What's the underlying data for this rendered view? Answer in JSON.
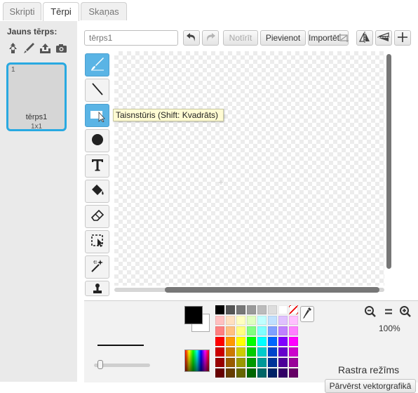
{
  "tabs": [
    {
      "label": "Skripti",
      "active": false
    },
    {
      "label": "Tērpi",
      "active": true
    },
    {
      "label": "Skaņas",
      "active": false
    }
  ],
  "sidebar": {
    "new_costume_label": "Jauns tērps:",
    "new_costume_icons": [
      "sprite-library-icon",
      "paint-brush-icon",
      "upload-icon",
      "camera-icon"
    ],
    "costume": {
      "number": "1",
      "name": "tērps1",
      "size": "1x1"
    }
  },
  "toolbar": {
    "name_placeholder": "tērps1",
    "undo_icon": "undo-icon",
    "redo_icon": "redo-icon",
    "clear_label": "Notīrīt",
    "add_label": "Pievienot",
    "import_label": "Importēt",
    "right_icons": [
      "flip-horizontal-icon",
      "flip-vertical-icon",
      "set-costume-center-icon"
    ]
  },
  "tools": [
    {
      "name": "brush-tool",
      "icon": "paintbrush-icon",
      "selected": true
    },
    {
      "name": "line-tool",
      "icon": "line-icon",
      "selected": false
    },
    {
      "name": "rectangle-tool",
      "icon": "rectangle-icon",
      "selected": true
    },
    {
      "name": "ellipse-tool",
      "icon": "ellipse-icon",
      "selected": false
    },
    {
      "name": "text-tool",
      "icon": "text-icon",
      "selected": false
    },
    {
      "name": "fill-tool",
      "icon": "paint-bucket-icon",
      "selected": false
    },
    {
      "name": "eraser-tool",
      "icon": "eraser-icon",
      "selected": false
    },
    {
      "name": "select-tool",
      "icon": "select-icon",
      "selected": false
    },
    {
      "name": "magic-wand-tool",
      "icon": "magic-wand-icon",
      "selected": false
    },
    {
      "name": "stamp-tool",
      "icon": "stamp-icon",
      "selected": false
    }
  ],
  "tooltip": {
    "text": "Taisnstūris (Shift: Kvadrāts)"
  },
  "bottom": {
    "zoom_level": "100%",
    "mode_label": "Rastra režīms",
    "convert_label": "Pārvērst vektorgrafikā",
    "foreground_color": "#000000",
    "background_color": "#ffffff",
    "palette": [
      "#000000",
      "#555555",
      "#777777",
      "#999999",
      "#bbbbbb",
      "#dddddd",
      "#ffffff",
      "transparent",
      "#ffc0c0",
      "#ffe0c0",
      "#ffffc0",
      "#e0ffc0",
      "#c0ffff",
      "#c0e0ff",
      "#e0c0ff",
      "#ffc0ff",
      "#ff8080",
      "#ffc080",
      "#ffff80",
      "#80ff80",
      "#80ffff",
      "#80a0ff",
      "#c080ff",
      "#ff80ff",
      "#ff0000",
      "#ff9900",
      "#ffff00",
      "#00ff00",
      "#00ffff",
      "#0066ff",
      "#8000ff",
      "#ff00ff",
      "#cc0000",
      "#cc7a00",
      "#cccc00",
      "#00cc00",
      "#00cccc",
      "#0044cc",
      "#6600cc",
      "#cc00cc",
      "#990000",
      "#995c00",
      "#999900",
      "#009900",
      "#009999",
      "#003399",
      "#4d0099",
      "#990099",
      "#660000",
      "#663d00",
      "#666600",
      "#006600",
      "#006666",
      "#002266",
      "#330066",
      "#660066"
    ]
  }
}
